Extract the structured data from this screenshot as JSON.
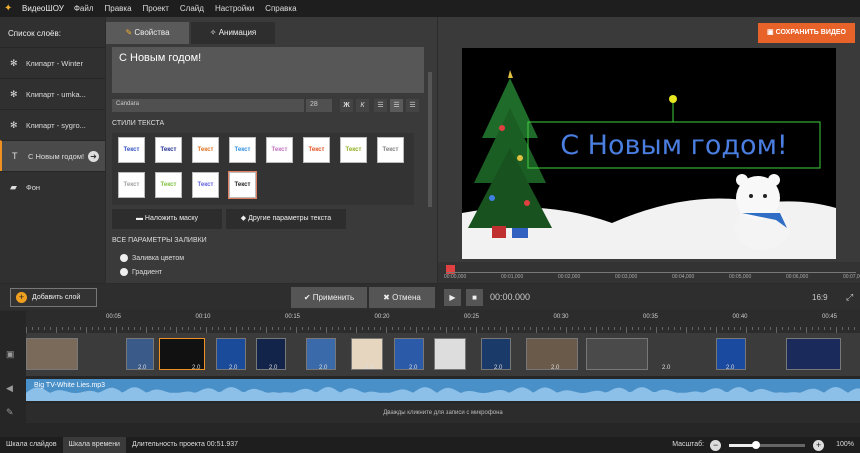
{
  "app": {
    "name": "ВидеоШОУ",
    "accent": "#f09020",
    "save_color": "#e8632a"
  },
  "menu": [
    "Файл",
    "Правка",
    "Проект",
    "Слайд",
    "Настройки",
    "Справка"
  ],
  "layers": {
    "title": "Список слоёв:",
    "items": [
      {
        "label": "Клипарт - Winter",
        "icon": "gear-icon"
      },
      {
        "label": "Клипарт - umka...",
        "icon": "gear-icon"
      },
      {
        "label": "Клипарт - sygro...",
        "icon": "gear-icon"
      },
      {
        "label": "С Новым годом!",
        "icon": "text-icon",
        "selected": true
      },
      {
        "label": "Фон",
        "icon": "background-icon"
      }
    ]
  },
  "props": {
    "tabs": [
      "Свойства",
      "Анимация"
    ],
    "text_value": "С Новым годом!",
    "font": "Candara",
    "size": "28",
    "styles_label": "СТИЛИ ТЕКСТА",
    "style_sample": "Текст",
    "style_colors": [
      "#3050c0",
      "#203090",
      "#e07020",
      "#3090e0",
      "#c070c0",
      "#e05020",
      "#90b020",
      "#808080",
      "#a0a0a0",
      "#80c040",
      "#6060e0",
      "#222222"
    ],
    "mask_button": "Наложить маску",
    "params_button": "Другие параметры текста",
    "fill_label": "ВСЕ ПАРАМЕТРЫ ЗАЛИВКИ",
    "fill_options": [
      "Заливка цветом",
      "Градиент"
    ]
  },
  "preview": {
    "save_button": "СОХРАНИТЬ ВИДЕО",
    "overlay_text": "С Новым годом!",
    "ruler": [
      "00:00,000",
      "00:01,000",
      "00:02,000",
      "00:03,000",
      "00:04,000",
      "00:05,000",
      "00:06,000",
      "00:07,000"
    ]
  },
  "actions": {
    "add_layer": "Добавить слой",
    "apply": "Применить",
    "cancel": "Отмена",
    "timecode": "00:00.000",
    "ratio": "16:9"
  },
  "timeline": {
    "ticks": [
      "00:05",
      "00:10",
      "00:15",
      "00:20",
      "00:25",
      "00:30",
      "00:35",
      "00:40",
      "00:45"
    ],
    "durations": [
      "2.0",
      "2.0",
      "2.0",
      "2.0",
      "2.0",
      "2.0",
      "2.0",
      "2.0",
      "2.0",
      "2.0",
      "2.0",
      "2.0"
    ],
    "audio_name": "Big TV-White Lies.mp3",
    "mic_hint": "Дважды кликните для записи с микрофона"
  },
  "status": {
    "tab_slides": "Шкала слайдов",
    "tab_timeline": "Шкала времени",
    "duration": "Длительность проекта 00:51.937",
    "zoom_label": "Масштаб:",
    "zoom_value": "100%",
    "zoom_level": 0.35
  }
}
